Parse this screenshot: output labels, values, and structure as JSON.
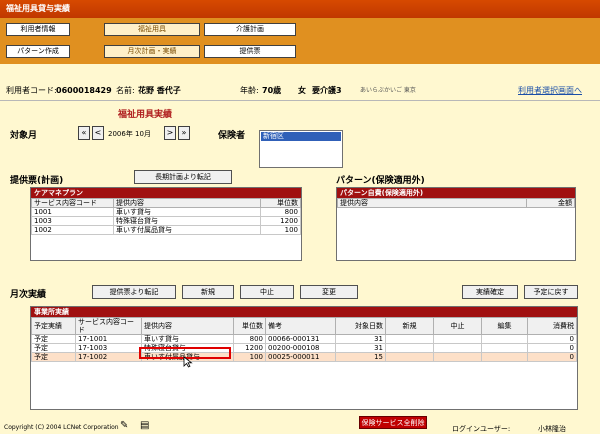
{
  "window": {
    "title": "福祉用具貸与実績"
  },
  "nav": {
    "row1": [
      "利用者情報",
      "福祉用具",
      "介護計画"
    ],
    "row2": [
      "パターン作成",
      "月次計画・実績",
      "提供票"
    ],
    "active": "福祉用具"
  },
  "userbar": {
    "code_label": "利用者コード:",
    "code_value": "0600018429",
    "name_label": "名前:",
    "name_value": "花野 香代子",
    "age_label": "年齢:",
    "age_value": "70歳",
    "gender": "女",
    "care_label": "要介護3",
    "kana": "あいらぶかいご 東京",
    "select_link": "利用者選択画面へ"
  },
  "page": {
    "heading": "福祉用具実績",
    "target_month_label": "対象月",
    "month_value": "2006年 10月",
    "insurer_label": "保険者",
    "insurer_selected": "新宿区"
  },
  "plan_section": {
    "title": "提供票(計画)",
    "transfer_btn": "長期計画より転記",
    "panel_title": "ケアマネプラン",
    "columns": [
      "サービス内容コード",
      "提供内容",
      "単位数"
    ],
    "rows": [
      [
        "1001",
        "車いす貸与",
        "800"
      ],
      [
        "1003",
        "特殊寝台貸与",
        "1200"
      ],
      [
        "1002",
        "車いす付属品貸与",
        "100"
      ]
    ]
  },
  "pattern_section": {
    "title": "パターン(保険適用外)",
    "panel_title": "パターン自費(保険適用外)",
    "columns": [
      "提供内容",
      "金額"
    ]
  },
  "monthly_section": {
    "title": "月次実績",
    "buttons": [
      "提供票より転記",
      "新規",
      "中止",
      "変更"
    ],
    "confirm_btn": "実績確定",
    "revert_btn": "予定に戻す",
    "panel_title": "事業所実績",
    "columns": [
      "予定実績",
      "サービス内容コード",
      "提供内容",
      "単位数",
      "備考",
      "対象日数",
      "新規",
      "中止",
      "編集",
      "消費税"
    ],
    "rows": [
      [
        "予定",
        "17-1001",
        "車いす貸与",
        "800",
        "00066-000131",
        "31",
        "",
        "",
        "",
        "0"
      ],
      [
        "予定",
        "17-1003",
        "特殊寝台貸与",
        "1200",
        "00200-000108",
        "31",
        "",
        "",
        "",
        "0"
      ],
      [
        "予定",
        "17-1002",
        "車いす付属品貸与",
        "100",
        "00025-000011",
        "15",
        "",
        "",
        "",
        "0"
      ]
    ]
  },
  "footer": {
    "copyright": "Copyright (C) 2004 LCNet Corporation",
    "delete_btn": "保険サービス全削除",
    "login_label": "ログインユーザー:",
    "login_user": "小林隆治"
  },
  "colors": {
    "title_bar": "#c84000",
    "nav_bg": "#e09020",
    "panel_head": "#a01010",
    "selection": "#3060b8"
  }
}
